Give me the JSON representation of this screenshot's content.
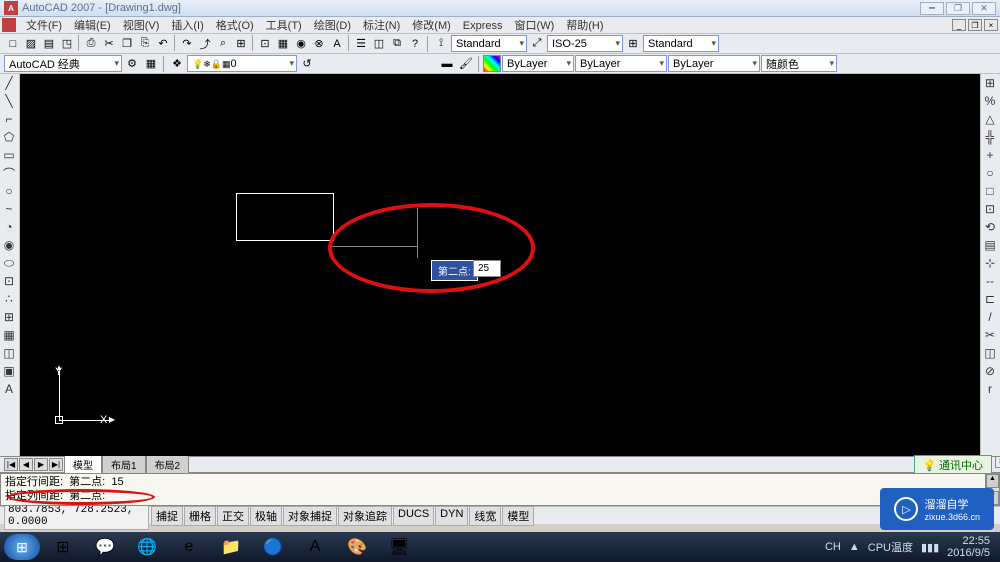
{
  "title": "AutoCAD 2007 - [Drawing1.dwg]",
  "menus": [
    "文件(F)",
    "编辑(E)",
    "视图(V)",
    "插入(I)",
    "格式(O)",
    "工具(T)",
    "绘图(D)",
    "标注(N)",
    "修改(M)",
    "Express",
    "窗口(W)",
    "帮助(H)"
  ],
  "toolbar1_icons": [
    "□",
    "▨",
    "▤",
    "◳",
    "⎙",
    "✂",
    "❐",
    "⎘",
    "↶",
    "↷",
    "⤴",
    "⌕",
    "⊞",
    "⊡",
    "▦",
    "◉",
    "⊗",
    "A",
    "☰",
    "◫",
    "⧉",
    "?"
  ],
  "style_combo1": "Standard",
  "style_combo2": "ISO-25",
  "style_combo3": "Standard",
  "workspace_combo": "AutoCAD 经典",
  "layer_combo": "0",
  "layer_icons": [
    "💡",
    "❄",
    "🔒",
    "▦"
  ],
  "prop_combo1": "ByLayer",
  "prop_combo2": "ByLayer",
  "prop_combo3": "ByLayer",
  "color_combo": "随颜色",
  "left_tools": [
    "╱",
    "╲",
    "⌐",
    "⬠",
    "▭",
    "⌒",
    "○",
    "~",
    "◔",
    "◉",
    "⬭",
    "⊡",
    "∴",
    "⊞",
    "▦",
    "◫",
    "▣",
    "A"
  ],
  "right_tools": [
    "⊞",
    "%",
    "△",
    "╬",
    "+",
    "○",
    "□",
    "⊡",
    "⟲",
    "▤",
    "⊹",
    "--",
    "⊏",
    "/",
    "✂",
    "◫",
    "⊘",
    "r"
  ],
  "dyn_label": "第二点:",
  "dyn_value": "25",
  "ucs": {
    "x": "X",
    "y": "Y"
  },
  "tabs": {
    "nav": [
      "|◀",
      "◀",
      "▶",
      "▶|"
    ],
    "items": [
      "模型",
      "布局1",
      "布局2"
    ]
  },
  "comm_center": "通讯中心",
  "cmd_lines": [
    "指定行间距:  第二点:  15",
    "指定列间距:  第二点:"
  ],
  "coords": "803.7853, 728.2523, 0.0000",
  "status_buttons": [
    "捕捉",
    "栅格",
    "正交",
    "极轴",
    "对象捕捉",
    "对象追踪",
    "DUCS",
    "DYN",
    "线宽",
    "模型"
  ],
  "tray": {
    "ime": "CH",
    "cpu": "CPU温度",
    "time": "22:55",
    "date": "2016/9/5"
  },
  "watermark": {
    "brand": "溜溜自学",
    "url": "zixue.3d66.cn"
  },
  "taskbar_icons": [
    "⊞",
    "💬",
    "🌐",
    "e",
    "📁",
    "🔵",
    "A",
    "🎨",
    "🖥"
  ]
}
